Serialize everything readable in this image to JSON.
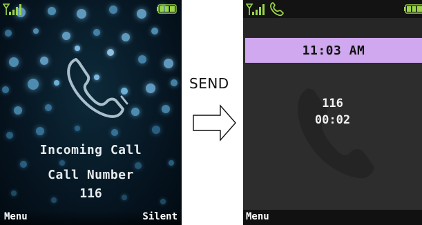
{
  "incoming_screen": {
    "status": {
      "signal_icon": "signal-strength-icon",
      "battery_icon": "battery-icon"
    },
    "phone_icon": "phone-handset-icon",
    "title": "Incoming Call",
    "call_number_label": "Call Number",
    "call_number": "116",
    "softkeys": {
      "left": "Menu",
      "right": "Silent"
    }
  },
  "transition": {
    "label": "SEND",
    "arrow_icon": "right-arrow-icon"
  },
  "active_call_screen": {
    "status": {
      "signal_icon": "signal-strength-icon",
      "call_icon": "phone-call-icon",
      "battery_icon": "battery-icon"
    },
    "time": "11:03 AM",
    "call_number": "116",
    "duration": "00:02",
    "softkeys": {
      "left": "Menu"
    },
    "colors": {
      "time_bar": "#cfa8ef",
      "background": "#2d2d2d"
    }
  }
}
